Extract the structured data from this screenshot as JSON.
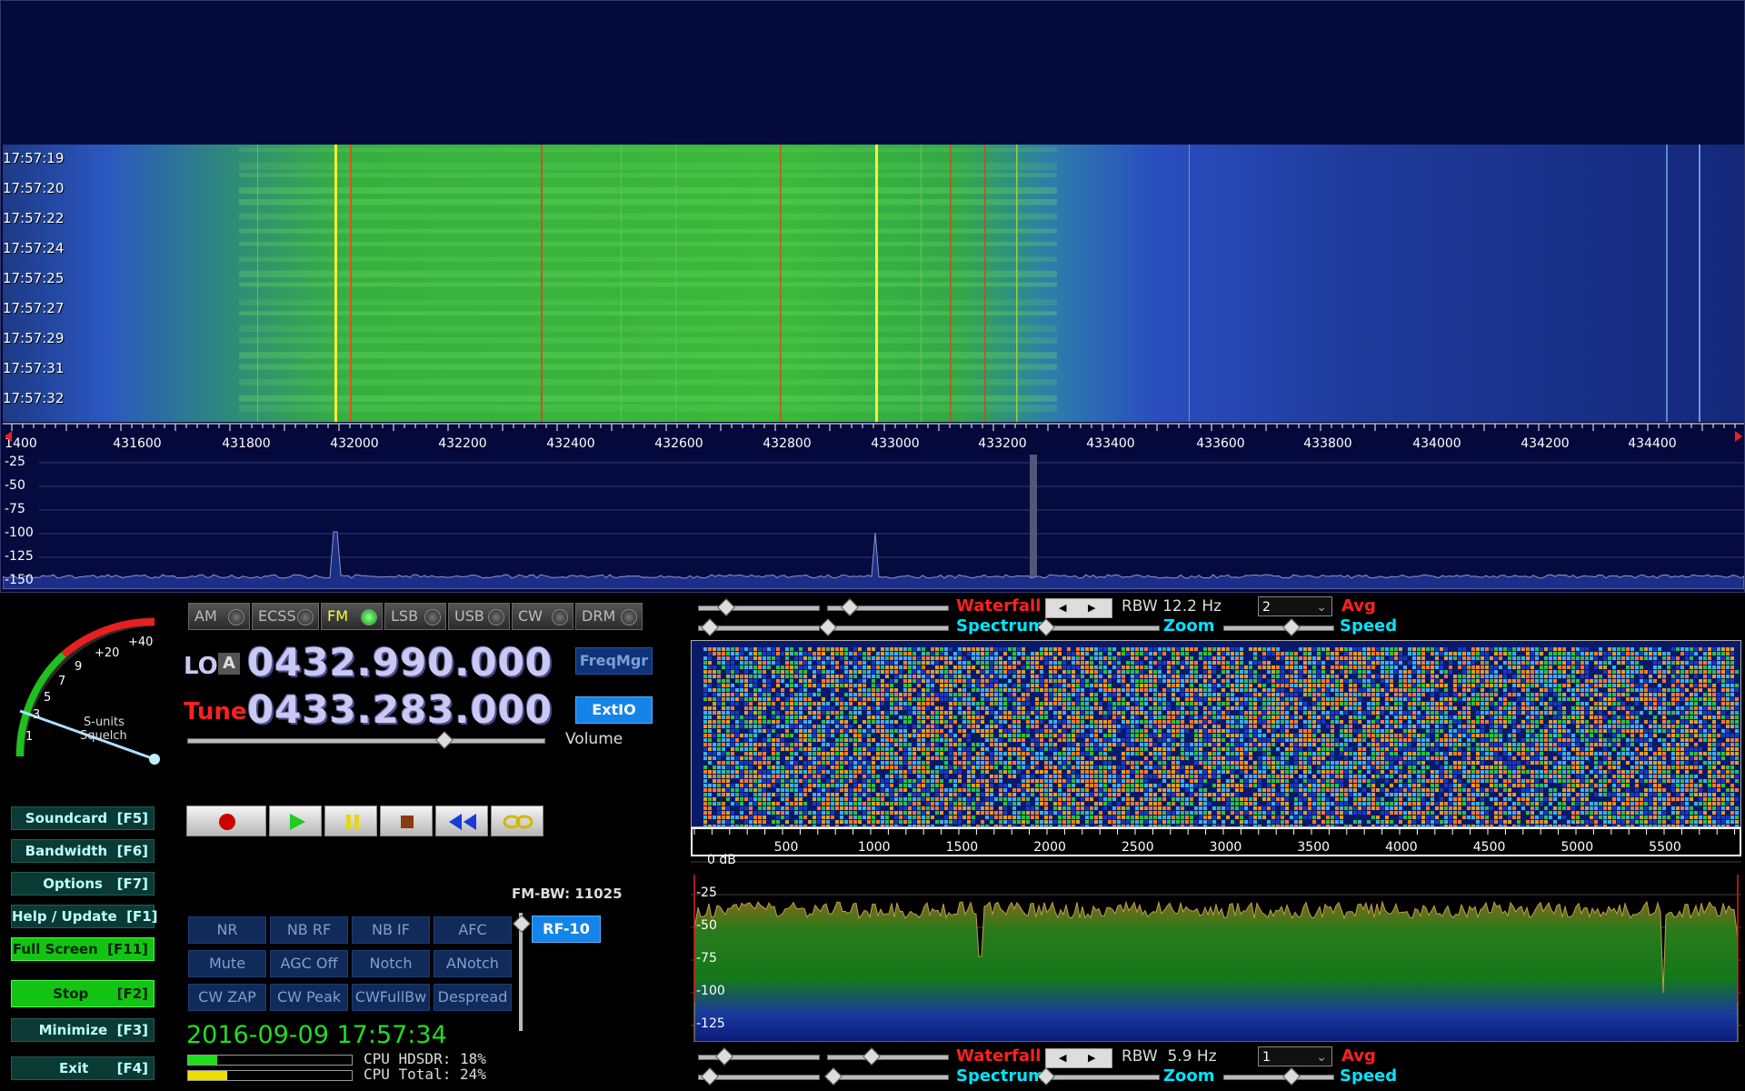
{
  "waterfall": {
    "timestamps": [
      "17:57:19",
      "17:57:20",
      "17:57:22",
      "17:57:24",
      "17:57:25",
      "17:57:27",
      "17:57:29",
      "17:57:31",
      "17:57:32"
    ],
    "freq_labels": [
      "1400",
      "431600",
      "431800",
      "432000",
      "432200",
      "432400",
      "432600",
      "432800",
      "433000",
      "433200",
      "433400",
      "433600",
      "433800",
      "434000",
      "434200",
      "434400"
    ]
  },
  "spectrum": {
    "db_labels": [
      "-25",
      "-50",
      "-75",
      "-100",
      "-125",
      "-150"
    ]
  },
  "modes": [
    {
      "label": "AM",
      "active": false
    },
    {
      "label": "ECSS",
      "active": false
    },
    {
      "label": "FM",
      "active": true
    },
    {
      "label": "LSB",
      "active": false
    },
    {
      "label": "USB",
      "active": false
    },
    {
      "label": "CW",
      "active": false
    },
    {
      "label": "DRM",
      "active": false
    }
  ],
  "smeter": {
    "scale": [
      "1",
      "3",
      "5",
      "7",
      "9",
      "+20",
      "+40"
    ],
    "label_sunits": "S-units",
    "label_squelch": "Squelch"
  },
  "lo": {
    "label": "LO",
    "badge": "A",
    "value": "0432.990.000"
  },
  "tune": {
    "label": "Tune",
    "value": "0433.283.000"
  },
  "buttons": {
    "freqmgr": "FreqMgr",
    "extio": "ExtIO",
    "volume": "Volume"
  },
  "side_buttons": [
    {
      "label": "Soundcard  [F5]",
      "green": false
    },
    {
      "label": "Bandwidth  [F6]",
      "green": false
    },
    {
      "label": "Options   [F7]",
      "green": false
    },
    {
      "label": "Help / Update  [F1]",
      "green": false
    },
    {
      "label": "Full Screen  [F11]",
      "green": true
    },
    {
      "label": "Stop      [F2]",
      "green": true
    },
    {
      "label": "Minimize  [F3]",
      "green": false
    },
    {
      "label": "Exit      [F4]",
      "green": false
    }
  ],
  "dsp": {
    "fm_bw": "FM-BW: 11025",
    "rf": "RF-10",
    "row1": [
      "NR",
      "NB RF",
      "NB IF",
      "AFC"
    ],
    "row2": [
      "Mute",
      "AGC Off",
      "Notch",
      "ANotch"
    ],
    "row3": [
      "CW ZAP",
      "CW Peak",
      "CWFullBw",
      "Despread"
    ]
  },
  "datetime": "2016-09-09 17:57:34",
  "cpu": {
    "hdsdr_label": "CPU HDSDR: 18%",
    "hdsdr_pct": 18,
    "total_label": "CPU Total: 24%",
    "total_pct": 24
  },
  "af_controls_top": {
    "waterfall": "Waterfall",
    "rbw": "RBW 12.2 Hz",
    "avg_value": "2",
    "avg": "Avg",
    "spectrum": "Spectrum",
    "zoom": "Zoom",
    "speed": "Speed"
  },
  "af_controls_bottom": {
    "waterfall": "Waterfall",
    "rbw": "RBW  5.9 Hz",
    "avg_value": "1",
    "avg": "Avg",
    "spectrum": "Spectrum",
    "zoom": "Zoom",
    "speed": "Speed"
  },
  "af_scale": [
    "500",
    "1000",
    "1500",
    "2000",
    "2500",
    "3000",
    "3500",
    "4000",
    "4500",
    "5000",
    "5500"
  ],
  "af_db": [
    "0 dB",
    "-25",
    "-50",
    "-75",
    "-100",
    "-125"
  ],
  "colors": {
    "waterfall_label": "#ff2020",
    "spectrum_label": "#00e5ff",
    "tune_label": "#ff2020",
    "lo_label": "#c9c9f4"
  }
}
